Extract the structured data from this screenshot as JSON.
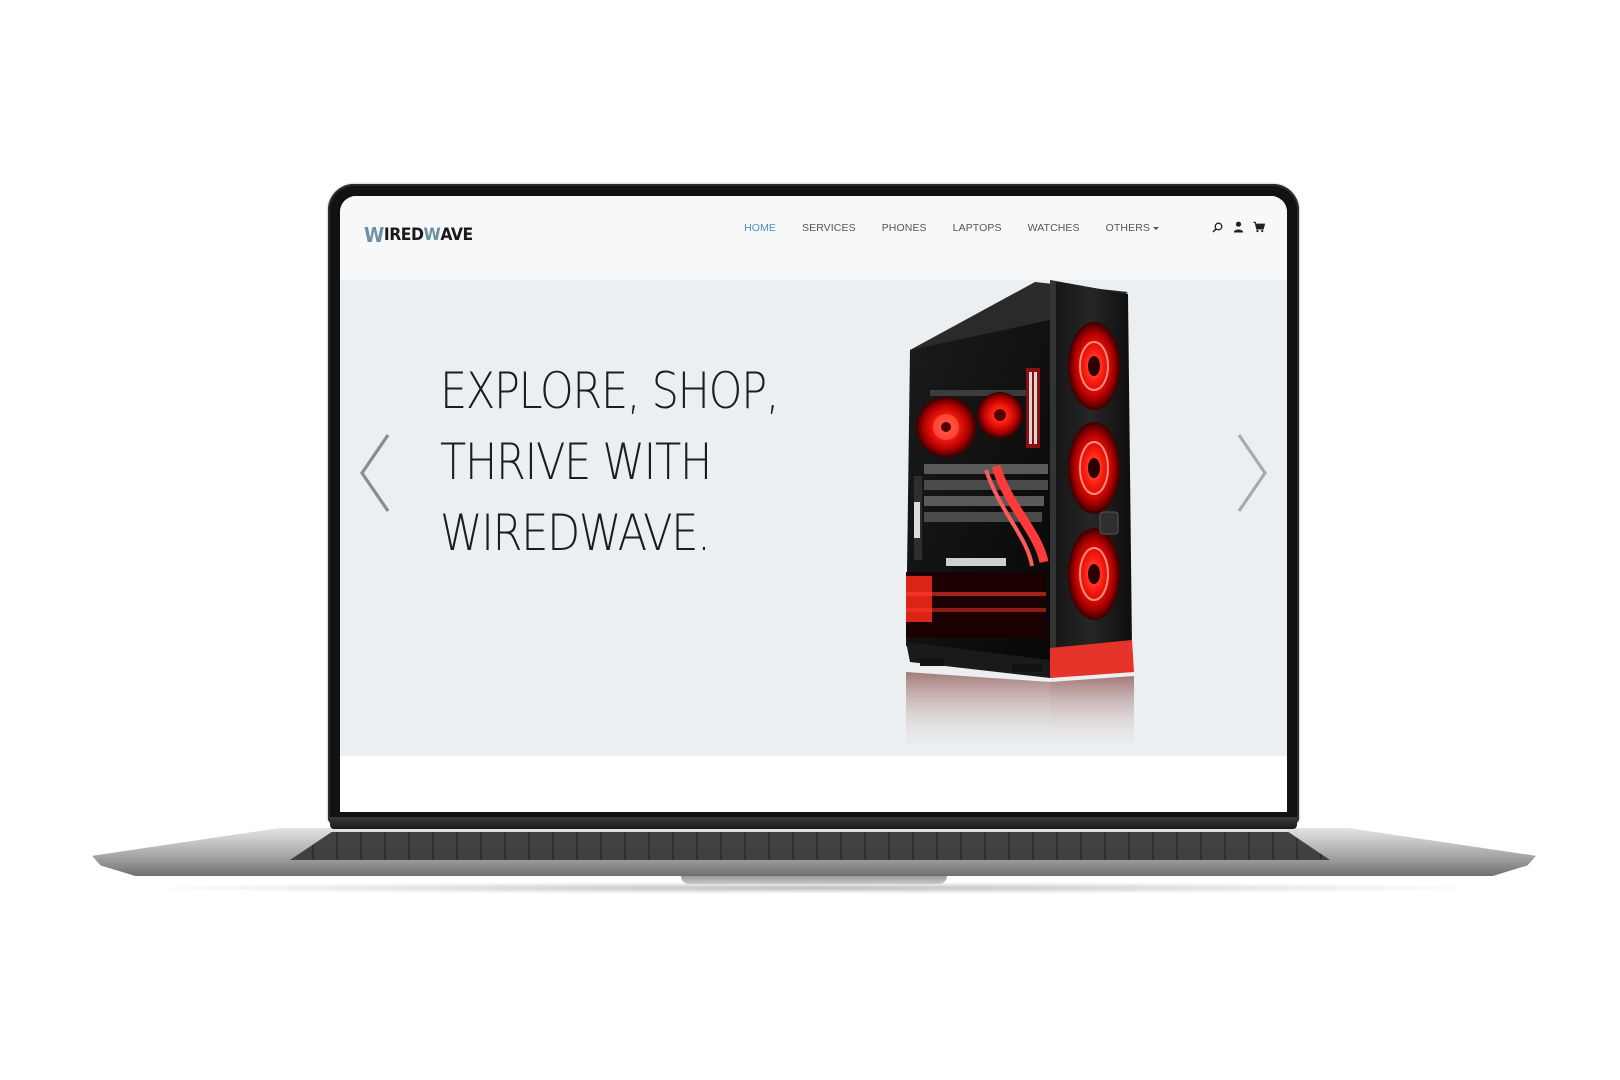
{
  "brand": {
    "logo_w1": "W",
    "logo_mid": "IRED",
    "logo_w2": "W",
    "logo_end": "AVE"
  },
  "nav": {
    "items": [
      {
        "label": "HOME",
        "active": true
      },
      {
        "label": "SERVICES",
        "active": false
      },
      {
        "label": "PHONES",
        "active": false
      },
      {
        "label": "LAPTOPS",
        "active": false
      },
      {
        "label": "WATCHES",
        "active": false
      },
      {
        "label": "OTHERS",
        "active": false,
        "dropdown": true
      }
    ],
    "icons": [
      "search-icon",
      "user-icon",
      "cart-icon"
    ]
  },
  "hero": {
    "line1": "EXPLORE, SHOP,",
    "line2": "THRIVE WITH",
    "line3": "WIREDWAVE.",
    "prev_icon": "chevron-left-icon",
    "next_icon": "chevron-right-icon",
    "image": "gaming-pc-case"
  },
  "colors": {
    "accent": "#4d8fbf",
    "hero_bg": "#eceff2",
    "nav_bg": "#f7f8f9",
    "led_red": "#ff2a1a"
  }
}
